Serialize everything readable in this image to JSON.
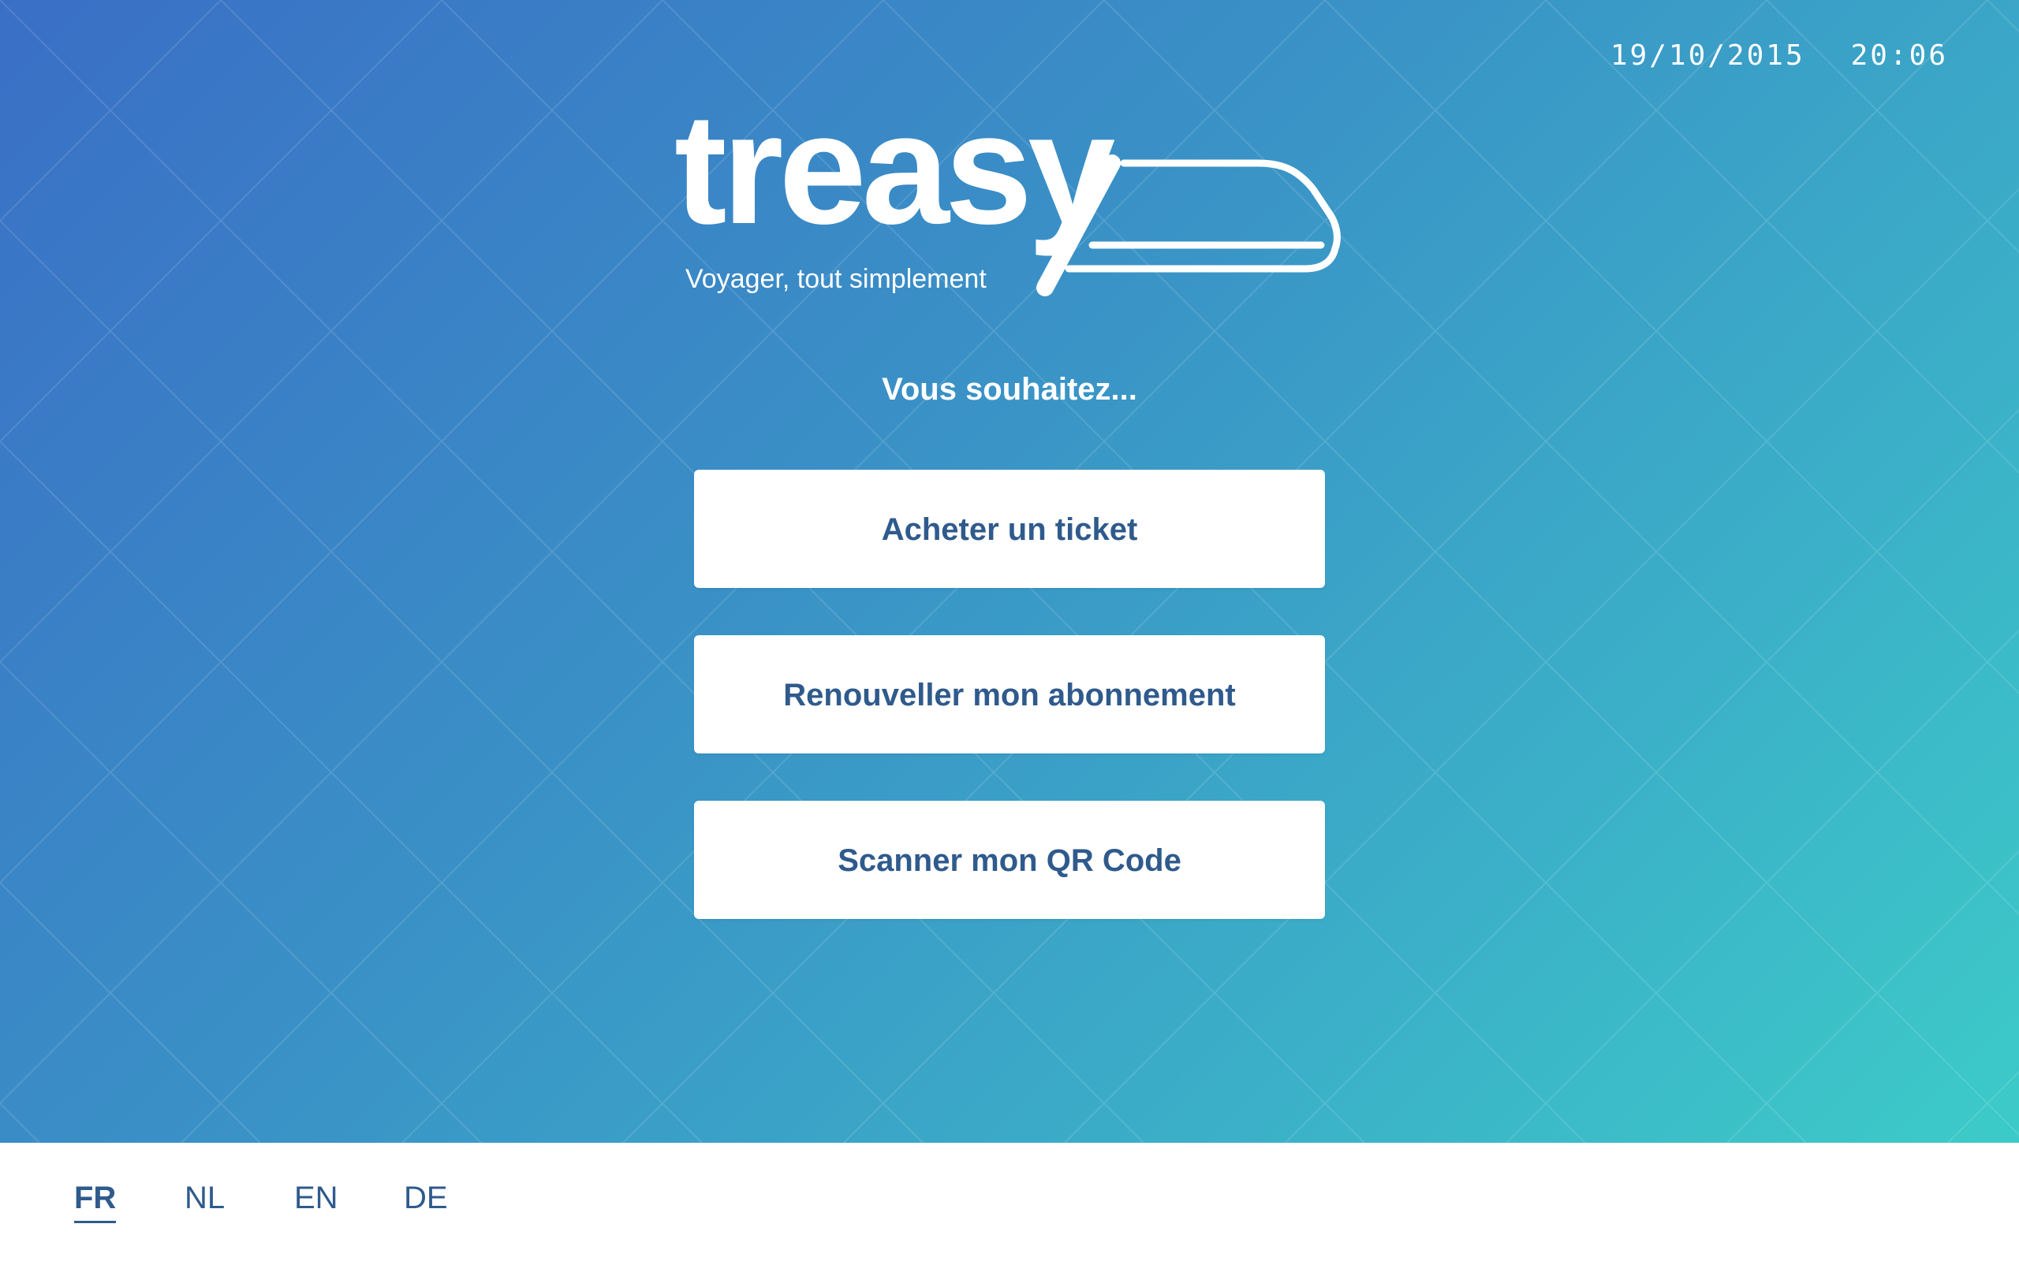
{
  "header": {
    "date": "19/10/2015",
    "time": "20:06"
  },
  "brand": {
    "name": "treasy",
    "tagline": "Voyager, tout simplement",
    "logo_icon": "train-icon"
  },
  "main": {
    "prompt": "Vous souhaitez...",
    "actions": [
      {
        "label": "Acheter un ticket"
      },
      {
        "label": "Renouveller mon abonnement"
      },
      {
        "label": "Scanner mon QR Code"
      }
    ]
  },
  "languages": {
    "items": [
      {
        "code": "FR",
        "active": true
      },
      {
        "code": "NL",
        "active": false
      },
      {
        "code": "EN",
        "active": false
      },
      {
        "code": "DE",
        "active": false
      }
    ]
  },
  "colors": {
    "gradient_start": "#3a6fc6",
    "gradient_end": "#3ccbc8",
    "button_text": "#2f5a8c",
    "background_white": "#ffffff"
  }
}
